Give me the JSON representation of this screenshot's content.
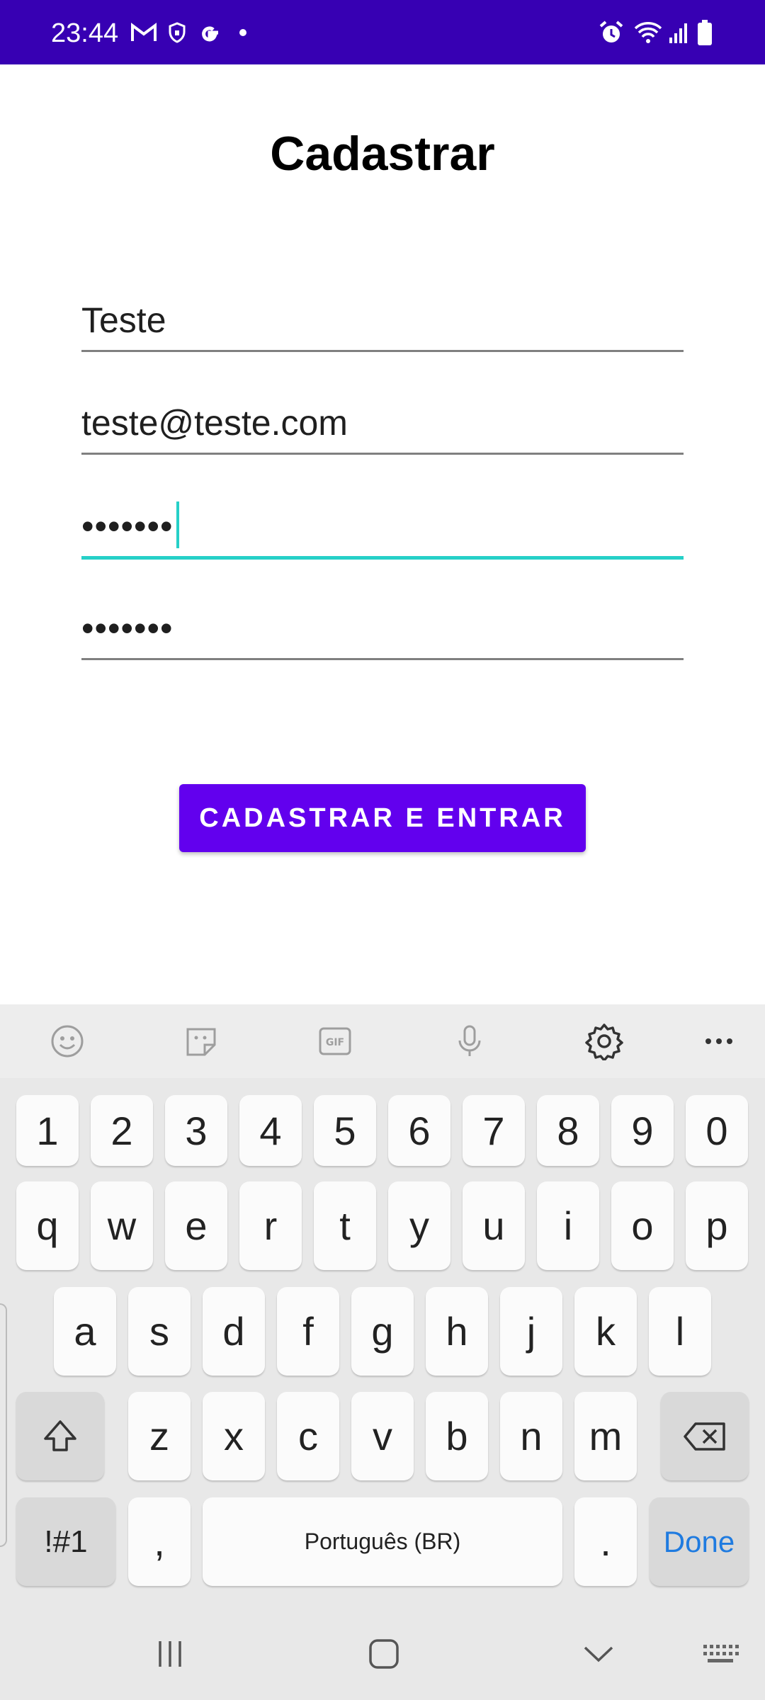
{
  "status_bar": {
    "time": "23:44",
    "icons_left": [
      "gmail-icon",
      "shield-icon",
      "google-icon",
      "notification-dot-icon"
    ],
    "icons_right": [
      "alarm-icon",
      "wifi-icon",
      "signal-icon",
      "battery-icon"
    ],
    "background": "#3700b3"
  },
  "page": {
    "title": "Cadastrar"
  },
  "form": {
    "name_value": "Teste",
    "email_value": "teste@teste.com",
    "password_value": "•••••••",
    "confirm_password_value": "•••••••",
    "focused_field": "password",
    "accent_color": "#26d0c8"
  },
  "button": {
    "label": "CADASTRAR E ENTRAR",
    "color": "#6200ee"
  },
  "keyboard": {
    "toolbar_icons": [
      "emoji-icon",
      "sticker-icon",
      "gif-icon",
      "microphone-icon",
      "settings-icon",
      "more-icon"
    ],
    "rows": {
      "numbers": [
        "1",
        "2",
        "3",
        "4",
        "5",
        "6",
        "7",
        "8",
        "9",
        "0"
      ],
      "row1": [
        "q",
        "w",
        "e",
        "r",
        "t",
        "y",
        "u",
        "i",
        "o",
        "p"
      ],
      "row2": [
        "a",
        "s",
        "d",
        "f",
        "g",
        "h",
        "j",
        "k",
        "l"
      ],
      "row3": [
        "z",
        "x",
        "c",
        "v",
        "b",
        "n",
        "m"
      ]
    },
    "symbols_label": "!#1",
    "comma_label": ",",
    "space_label": "Português (BR)",
    "period_label": ".",
    "done_label": "Done"
  },
  "nav_bar": {
    "icons": [
      "recents-icon",
      "home-icon",
      "hide-keyboard-icon",
      "keyboard-switch-icon"
    ]
  }
}
